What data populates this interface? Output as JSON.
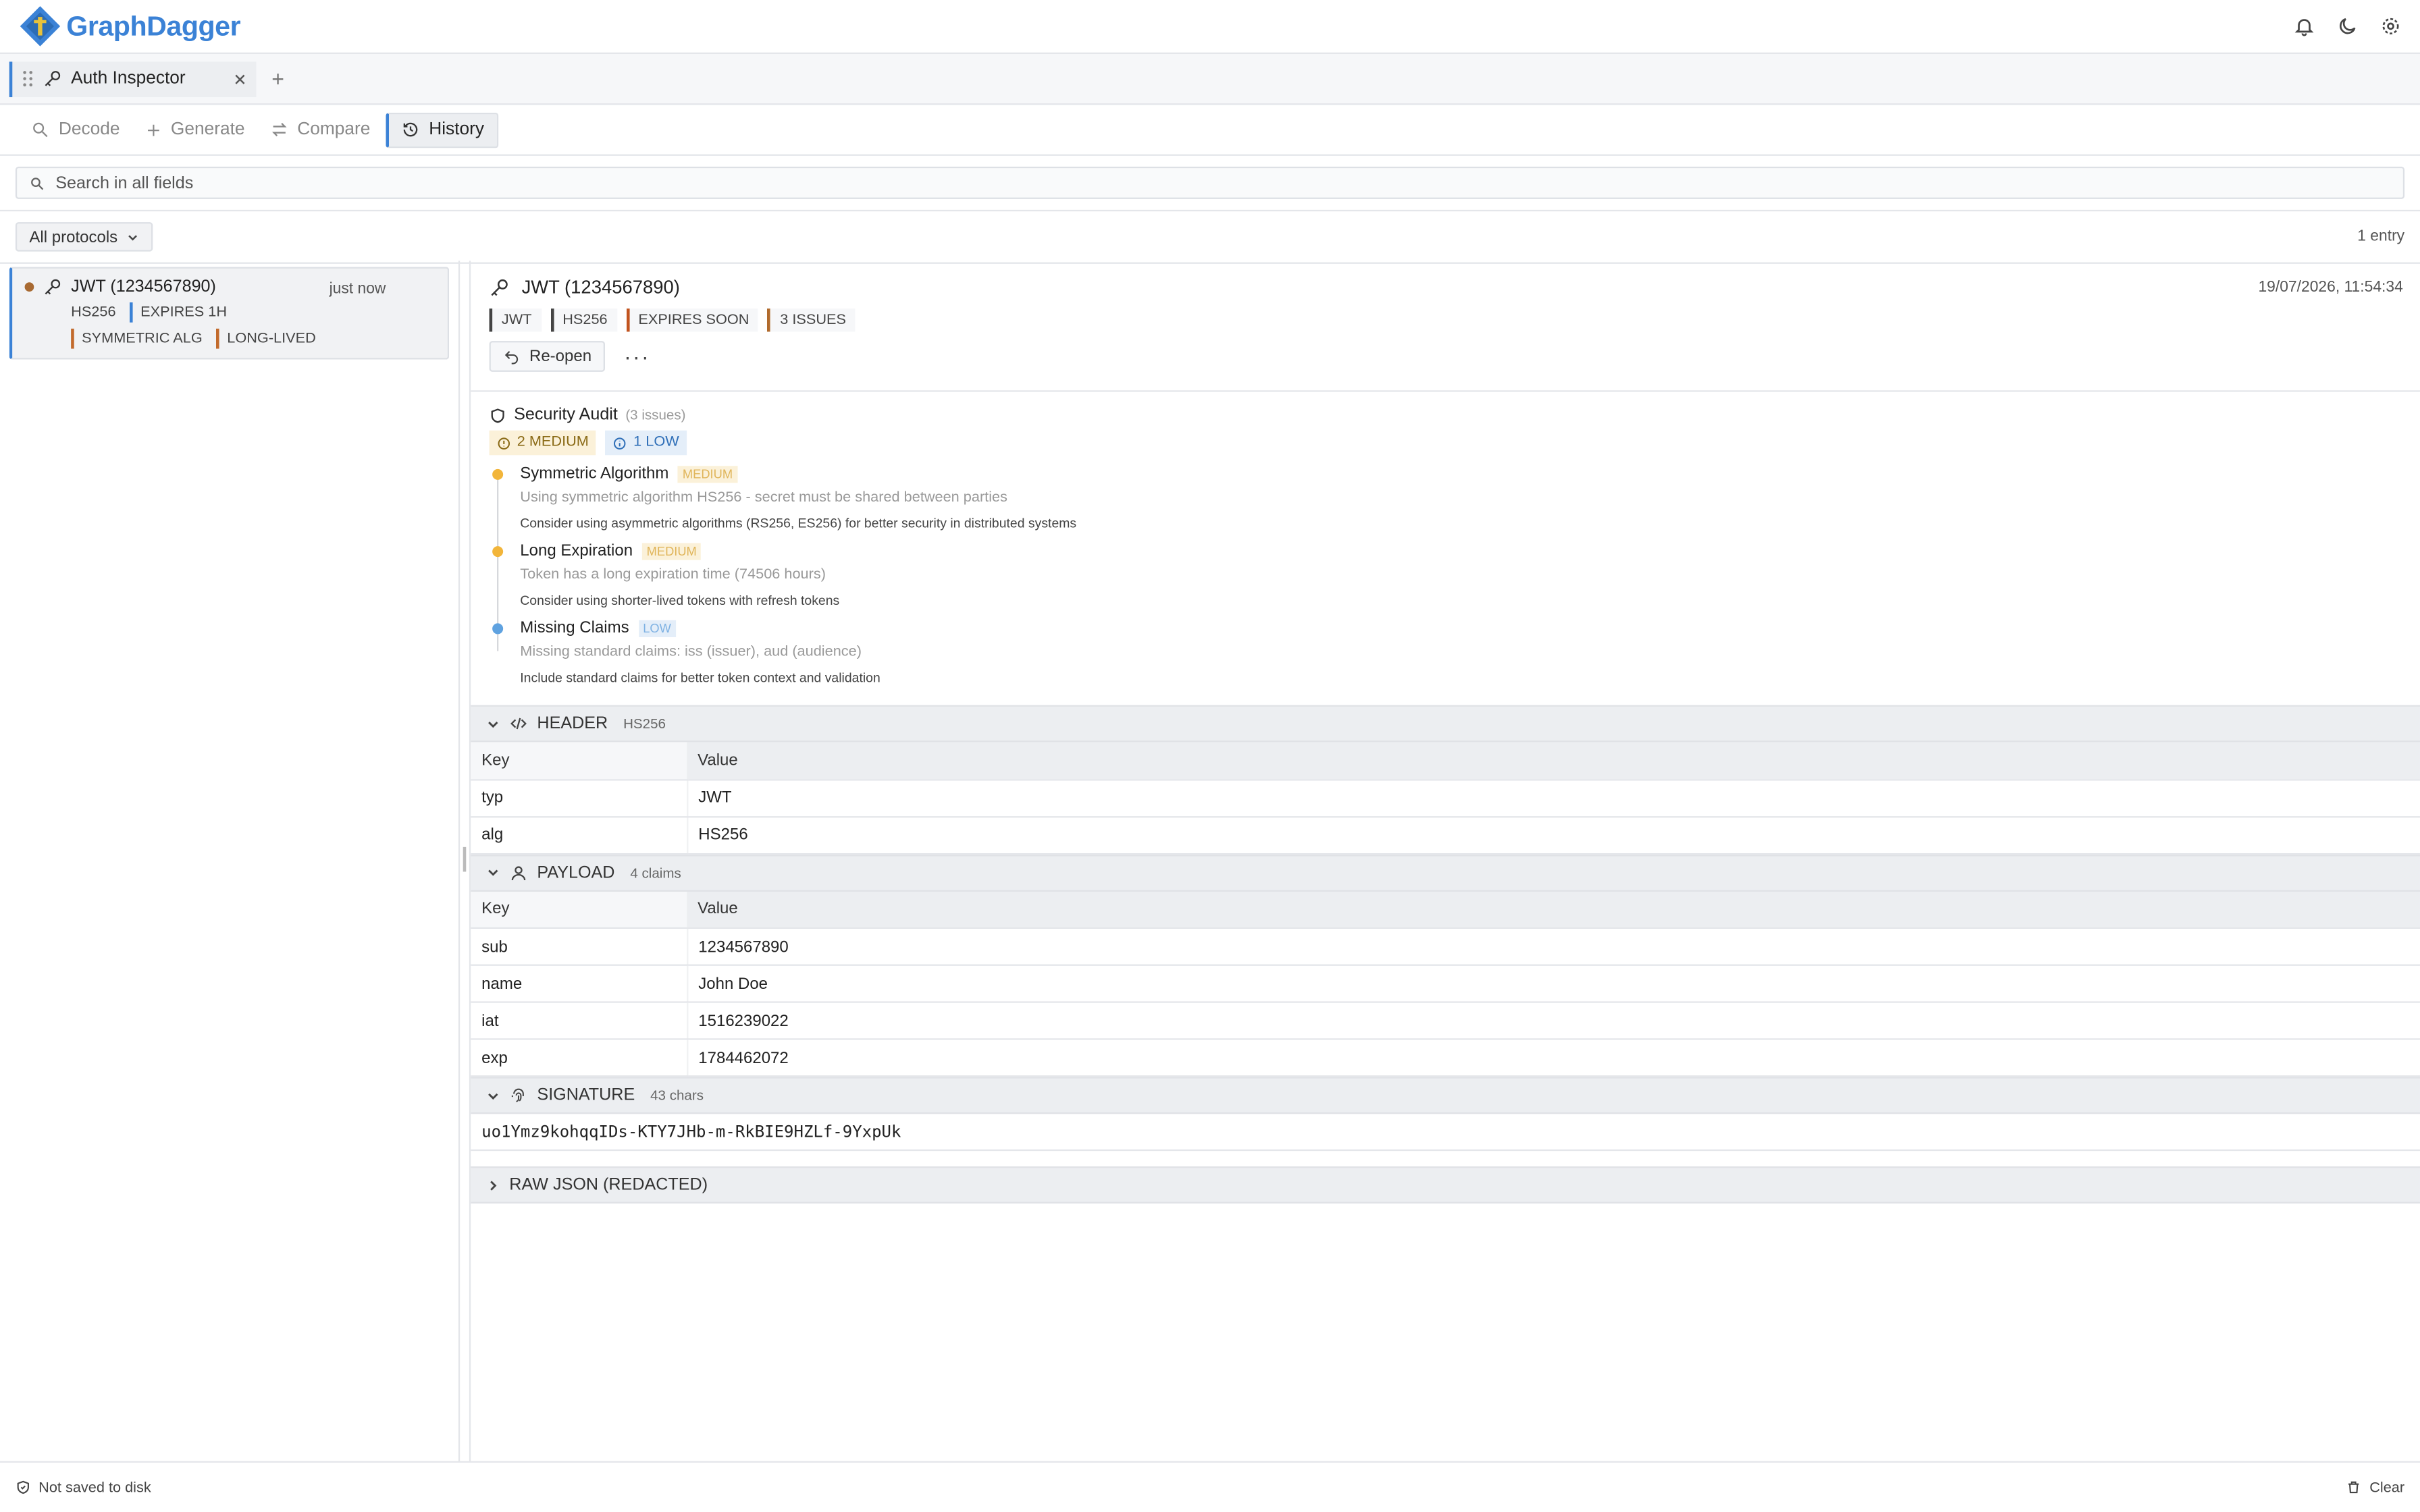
{
  "app": {
    "brand": "GraphDagger"
  },
  "tabs": [
    {
      "label": "Auth Inspector"
    }
  ],
  "modes": [
    {
      "label": "Decode",
      "icon": "search-icon"
    },
    {
      "label": "Generate",
      "icon": "plus-icon"
    },
    {
      "label": "Compare",
      "icon": "swap-icon"
    },
    {
      "label": "History",
      "icon": "history-icon",
      "active": true
    }
  ],
  "search": {
    "placeholder": "Search in all fields"
  },
  "filter": {
    "protocol": "All protocols",
    "count": "1 entry"
  },
  "history": {
    "items": [
      {
        "title": "JWT (1234567890)",
        "time": "just now",
        "chips": [
          "HS256",
          "EXPIRES 1H",
          "SYMMETRIC ALG",
          "LONG-LIVED"
        ]
      }
    ]
  },
  "detail": {
    "title": "JWT (1234567890)",
    "date": "19/07/2026, 11:54:34",
    "tags": [
      "JWT",
      "HS256",
      "EXPIRES SOON",
      "3 ISSUES"
    ],
    "reopen": "Re-open",
    "more": "···"
  },
  "audit": {
    "title": "Security Audit",
    "subtitle": "(3 issues)",
    "medium_badge": "2 MEDIUM",
    "low_badge": "1 LOW",
    "issues": [
      {
        "title": "Symmetric Algorithm",
        "severity": "MEDIUM",
        "desc": "Using symmetric algorithm HS256 - secret must be shared between parties",
        "fix": "Consider using asymmetric algorithms (RS256, ES256) for better security in distributed systems"
      },
      {
        "title": "Long Expiration",
        "severity": "MEDIUM",
        "desc": "Token has a long expiration time (74506 hours)",
        "fix": "Consider using shorter-lived tokens with refresh tokens"
      },
      {
        "title": "Missing Claims",
        "severity": "LOW",
        "desc": "Missing standard claims: iss (issuer), aud (audience)",
        "fix": "Include standard claims for better token context and validation"
      }
    ]
  },
  "header_section": {
    "title": "HEADER",
    "meta": "HS256",
    "col_key": "Key",
    "col_value": "Value",
    "rows": [
      {
        "key": "typ",
        "value": "JWT"
      },
      {
        "key": "alg",
        "value": "HS256"
      }
    ]
  },
  "payload_section": {
    "title": "PAYLOAD",
    "meta": "4 claims",
    "col_key": "Key",
    "col_value": "Value",
    "rows": [
      {
        "key": "sub",
        "value": "1234567890"
      },
      {
        "key": "name",
        "value": "John Doe"
      },
      {
        "key": "iat",
        "value": "1516239022"
      },
      {
        "key": "exp",
        "value": "1784462072"
      }
    ]
  },
  "signature_section": {
    "title": "SIGNATURE",
    "meta": "43 chars",
    "value": "uo1Ymz9kohqqIDs-KTY7JHb-m-RkBIE9HZLf-9YxpUk"
  },
  "raw_section": {
    "title": "RAW JSON (REDACTED)"
  },
  "footer": {
    "status": "Not saved to disk",
    "clear": "Clear"
  },
  "colors": {
    "accent": "#3b82d6",
    "medium": "#f2b53a",
    "low": "#5fa2e0",
    "orange": "#c2541f"
  }
}
